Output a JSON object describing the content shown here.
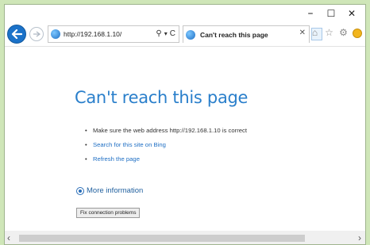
{
  "window": {
    "controls": {
      "minimize": "–",
      "maximize": "☐",
      "close": "✕"
    }
  },
  "toolbar": {
    "url": "http://192.168.1.10/",
    "search_glyph": "⚲",
    "dropdown_glyph": "▾",
    "refresh_glyph": "C",
    "tab_title": "Can't reach this page",
    "tab_close": "✕",
    "icons": [
      "home-icon",
      "favorites-icon",
      "settings-gear-icon",
      "feedback-smiley-icon"
    ]
  },
  "content": {
    "title": "Can't reach this page",
    "bullets": [
      {
        "text": "Make sure the web address http://192.168.1.10 is correct",
        "link": false
      },
      {
        "text": "Search for this site on Bing",
        "link": true
      },
      {
        "text": "Refresh the page",
        "link": true
      }
    ],
    "more_info": "More information",
    "fix_button": "Fix connection problems"
  },
  "colors": {
    "accent": "#2a7fcb",
    "back_button": "#1b72c9",
    "frame": "#cfe6b8"
  }
}
